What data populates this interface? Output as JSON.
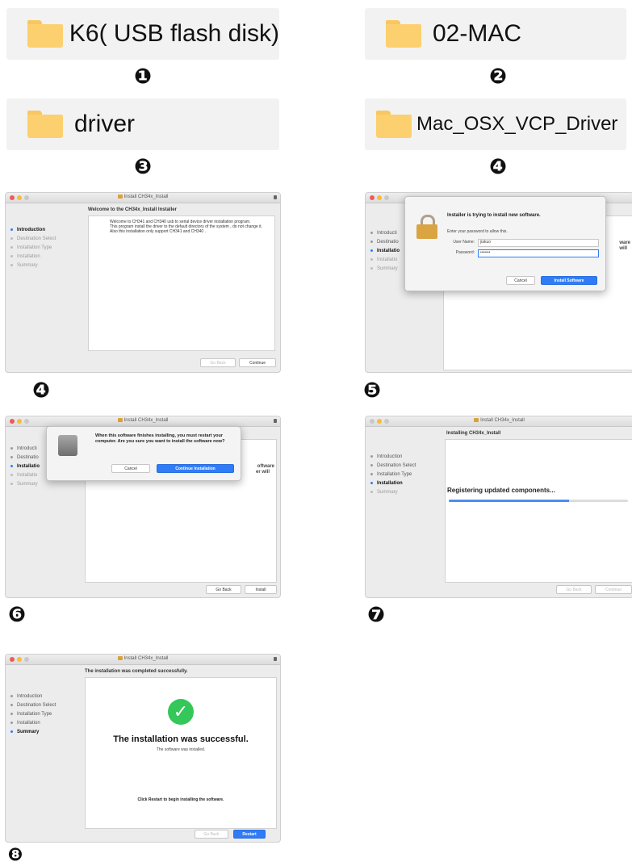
{
  "folders": [
    {
      "label": "K6( USB flash disk)",
      "step": "❶"
    },
    {
      "label": "02-MAC",
      "step": "❷"
    },
    {
      "label": "driver",
      "step": "❸"
    },
    {
      "label": "Mac_OSX_VCP_Driver",
      "step": "❹"
    }
  ],
  "window_title": "Install CH34x_Install",
  "sidebar": [
    "Introduction",
    "Destination Select",
    "Installation Type",
    "Installation",
    "Summary"
  ],
  "sidebar_partial": [
    "Introducti",
    "Destinatio",
    "Installatio",
    "Installatio",
    "Summary"
  ],
  "buttons": {
    "go_back": "Go Back",
    "continue": "Continue",
    "install": "Install",
    "restart": "Restart"
  },
  "s4": {
    "step": "❹",
    "heading": "Welcome to the CH34x_Install Installer",
    "body1": "Welcome to CH341 and CH340 usb to serial device driver installation program.",
    "body2": "This program install the driver to the default directory of the system , do not change it.",
    "body3": "Also this installation only support CH341 and CH340 ."
  },
  "s5": {
    "step": "❺",
    "title": "Installer is trying to install new software.",
    "sub": "Enter your password to allow this.",
    "user_label": "User Name:",
    "user_value": "jiakuo",
    "pass_label": "Password:",
    "pass_value": "•••••••",
    "cancel": "Cancel",
    "install_sw": "Install Software",
    "peek1": "ware",
    "peek2": "will"
  },
  "s6": {
    "step": "❻",
    "text": "When this software finishes installing, you must restart your computer. Are you sure you want to install the software now?",
    "cancel": "Cancel",
    "continue_install": "Continue Installation",
    "peek1": "oftware",
    "peek2": "er will"
  },
  "s7": {
    "step": "❼",
    "heading": "Installing CH34x_Install",
    "status": "Registering updated components...",
    "progress": 0.67
  },
  "s8": {
    "step": "❽",
    "heading": "The installation was completed successfully.",
    "success": "The installation was successful.",
    "sub": "The software was installed.",
    "restart_msg": "Click Restart to begin installing the software."
  },
  "colors": {
    "accent": "#2f7cf6",
    "success": "#34c759",
    "folder": "#fcd06e"
  }
}
